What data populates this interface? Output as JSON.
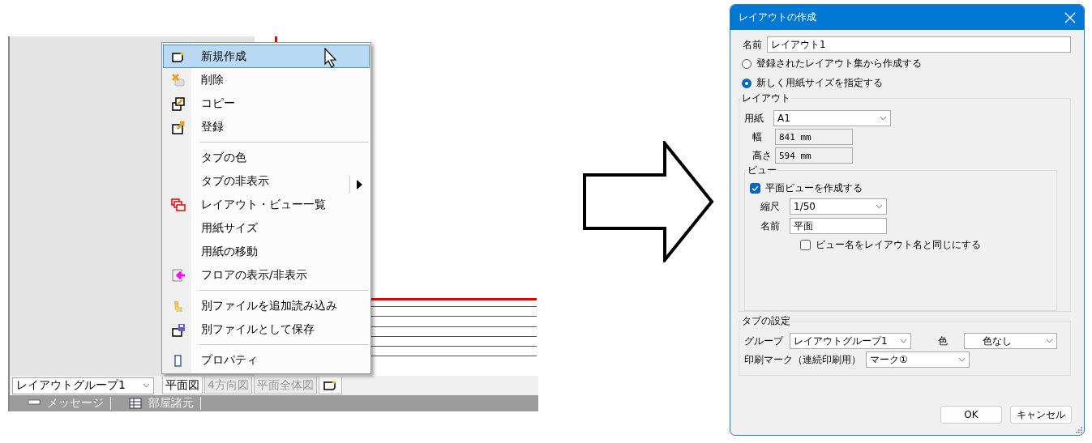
{
  "app": {
    "layout_group": "レイアウトグループ1",
    "tabs": [
      {
        "label": "平面図",
        "selected": true
      },
      {
        "label": "4方向図",
        "selected": false
      },
      {
        "label": "平面全体図",
        "selected": false
      }
    ],
    "status_items": [
      "メッセージ",
      "部屋諸元"
    ]
  },
  "context_menu": {
    "items": [
      {
        "kind": "item",
        "label": "新規作成",
        "selected": true,
        "has_submenu": false
      },
      {
        "kind": "item",
        "label": "削除",
        "selected": false,
        "has_submenu": false
      },
      {
        "kind": "item",
        "label": "コピー",
        "selected": false,
        "has_submenu": false
      },
      {
        "kind": "item",
        "label": "登録",
        "selected": false,
        "has_submenu": false
      },
      {
        "kind": "separator"
      },
      {
        "kind": "item",
        "label": "タブの色",
        "selected": false,
        "has_submenu": false
      },
      {
        "kind": "item",
        "label": "タブの非表示",
        "selected": false,
        "has_submenu": true
      },
      {
        "kind": "item",
        "label": "レイアウト・ビュー一覧",
        "selected": false,
        "has_submenu": false
      },
      {
        "kind": "item",
        "label": "用紙サイズ",
        "selected": false,
        "has_submenu": false
      },
      {
        "kind": "item",
        "label": "用紙の移動",
        "selected": false,
        "has_submenu": false
      },
      {
        "kind": "item",
        "label": "フロアの表示/非表示",
        "selected": false,
        "has_submenu": false
      },
      {
        "kind": "separator"
      },
      {
        "kind": "item",
        "label": "別ファイルを追加読み込み",
        "selected": false,
        "has_submenu": false
      },
      {
        "kind": "item",
        "label": "別ファイルとして保存",
        "selected": false,
        "has_submenu": false
      },
      {
        "kind": "separator"
      },
      {
        "kind": "item",
        "label": "プロパティ",
        "selected": false,
        "has_submenu": false
      }
    ]
  },
  "dialog": {
    "title": "レイアウトの作成",
    "name_label": "名前",
    "name_value": "レイアウト1",
    "source_options": [
      {
        "label": "登録されたレイアウト集から作成する",
        "selected": false
      },
      {
        "label": "新しく用紙サイズを指定する",
        "selected": true
      }
    ],
    "layout_group": {
      "title": "レイアウト",
      "paper_label": "用紙",
      "paper_value": "A1",
      "width_label": "幅",
      "width_value": "841 mm",
      "height_label": "高さ",
      "height_value": "594 mm"
    },
    "view_group": {
      "title": "ビュー",
      "create_plan": {
        "label": "平面ビューを作成する",
        "checked": true
      },
      "scale_label": "縮尺",
      "scale_value": "1/50",
      "name_label": "名前",
      "name_value": "平面",
      "same_name": {
        "label": "ビュー名をレイアウト名と同じにする",
        "checked": false
      }
    },
    "tab_settings": {
      "title": "タブの設定",
      "group_label": "グループ",
      "group_value": "レイアウトグループ1",
      "color_label": "色",
      "color_value": "色なし",
      "print_mark_label": "印刷マーク（連続印刷用）",
      "print_mark_value": "マーク①"
    },
    "buttons": [
      "OK",
      "キャンセル"
    ]
  }
}
